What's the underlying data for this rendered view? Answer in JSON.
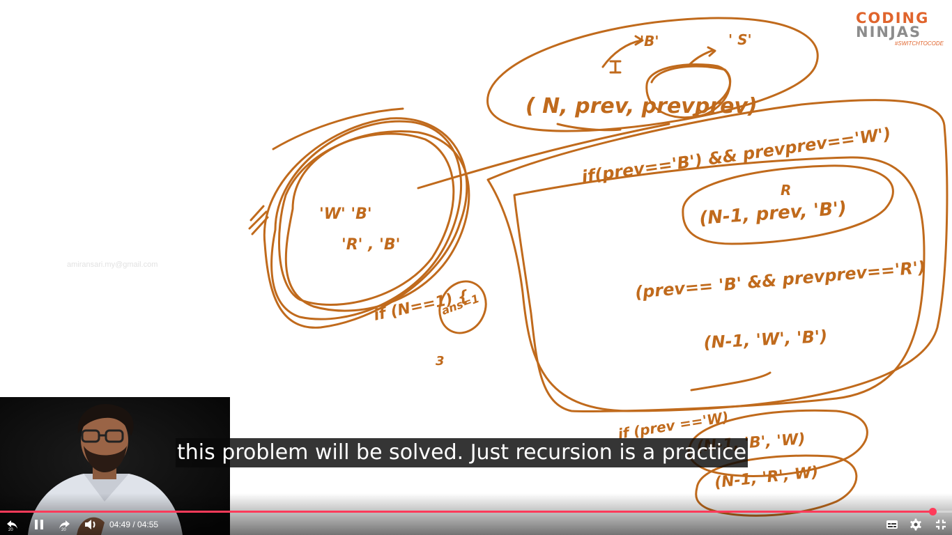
{
  "watermark": {
    "email": "amiransari.my@gmail.com"
  },
  "brand": {
    "line1": "CODING",
    "line2": "NINJAS",
    "tagline": "#SWITCHTOCODE",
    "color": "#e0642c"
  },
  "whiteboard": {
    "ink_color": "#c06a1c",
    "notes": {
      "top_call": "( N, prev, prevprev)",
      "top_b": "'B'",
      "top_s": "' S'",
      "circle_w_b": "'W'  'B'",
      "circle_r_b": "'R' , 'B'",
      "base_case": "if (N==1) {",
      "ans": "ans=1",
      "three": "3",
      "cond1": "if(prev=='B') && prevprev=='W')",
      "r_mark": "R",
      "call1": "(N-1,  prev,  'B')",
      "cond2": "(prev== 'B' && prevprev=='R')",
      "call2": "(N-1, 'W', 'B')",
      "cond3": "if (prev =='W)",
      "call3": "(N-1, 'B', 'W)",
      "call4": "(N-1, 'R', W)"
    }
  },
  "caption": {
    "text": "this problem will be solved. Just recursion is a practice"
  },
  "player": {
    "accent_color": "#ff3b5a",
    "progress": 0.9797,
    "current_time": "04:49",
    "duration": "04:55",
    "time_separator": " / ",
    "rewind_seconds": "20",
    "forward_seconds": "20",
    "icons": {
      "rewind": "rewind-20-icon",
      "pause": "pause-icon",
      "forward": "forward-20-icon",
      "volume": "volume-icon",
      "captions": "captions-icon",
      "settings": "gear-icon",
      "exit_fullscreen": "exit-fullscreen-icon"
    }
  }
}
